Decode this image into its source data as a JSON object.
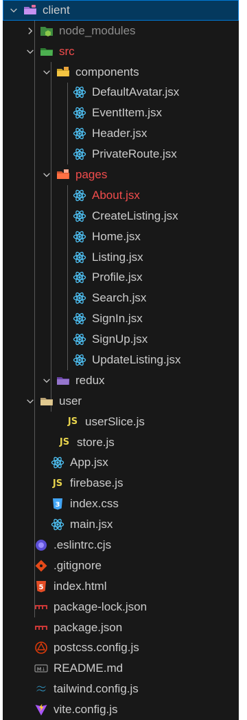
{
  "tree": {
    "root_label": "client",
    "node_modules_label": "node_modules",
    "src_label": "src",
    "components_label": "components",
    "components_files": [
      "DefaultAvatar.jsx",
      "EventItem.jsx",
      "Header.jsx",
      "PrivateRoute.jsx"
    ],
    "pages_label": "pages",
    "pages_files": [
      "About.jsx",
      "CreateListing.jsx",
      "Home.jsx",
      "Listing.jsx",
      "Profile.jsx",
      "Search.jsx",
      "SignIn.jsx",
      "SignUp.jsx",
      "UpdateListing.jsx"
    ],
    "redux_label": "redux",
    "user_label": "user",
    "user_slice_label": "userSlice.js",
    "store_label": "store.js",
    "app_label": "App.jsx",
    "firebase_label": "firebase.js",
    "index_css_label": "index.css",
    "main_label": "main.jsx",
    "eslintrc_label": ".eslintrc.cjs",
    "gitignore_label": ".gitignore",
    "index_html_label": "index.html",
    "package_lock_label": "package-lock.json",
    "package_label": "package.json",
    "postcss_label": "postcss.config.js",
    "readme_label": "README.md",
    "tailwind_label": "tailwind.config.js",
    "vite_label": "vite.config.js"
  },
  "icons": {
    "js_text": "JS",
    "css_text": "3",
    "html_text": "5",
    "md_text": "M↓"
  },
  "colors": {
    "background": "#181818",
    "selected": "#04395e",
    "error_text": "#f14c4c",
    "react_blue": "#4fc3f7",
    "js_yellow": "#e8d44d"
  }
}
